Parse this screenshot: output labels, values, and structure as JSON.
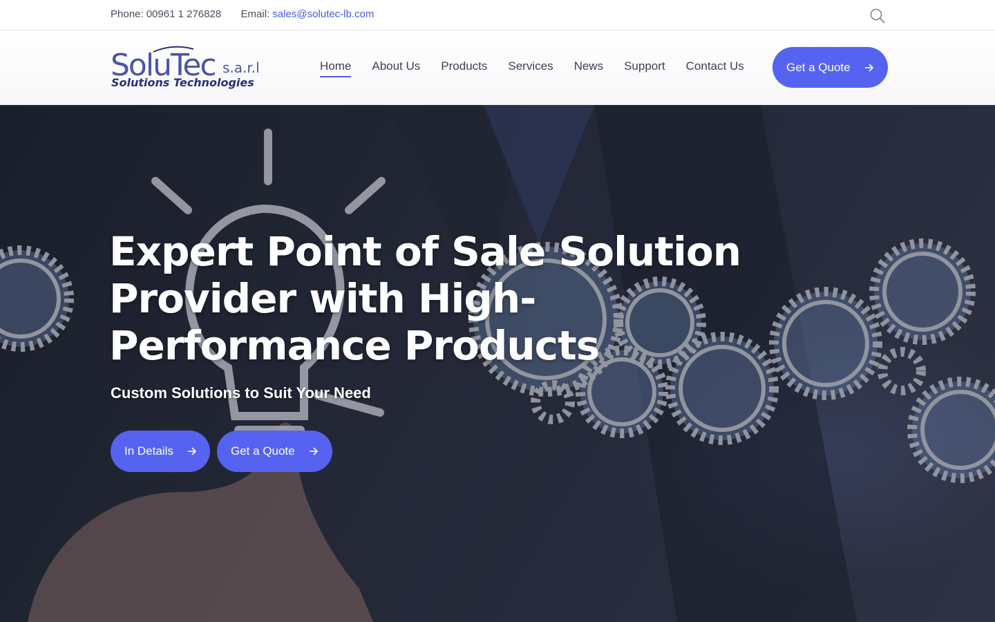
{
  "topbar": {
    "phone_label": "Phone:",
    "phone": "00961 1 276828",
    "email_label": "Email:",
    "email": "sales@solutec-lb.com",
    "search_icon": "search-icon"
  },
  "header": {
    "logo": {
      "name": "SoluTec",
      "suffix": "s.a.r.l",
      "tagline": "Solutions Technologies"
    },
    "nav": [
      {
        "label": "Home",
        "active": true
      },
      {
        "label": "About Us"
      },
      {
        "label": "Products"
      },
      {
        "label": "Services"
      },
      {
        "label": "News"
      },
      {
        "label": "Support"
      },
      {
        "label": "Contact Us"
      }
    ],
    "cta_label": "Get a Quote",
    "cta_icon": "arrow-right-icon"
  },
  "hero": {
    "title": "Expert Point of Sale Solution Provider with High- Performance Products",
    "subtitle": "Custom Solutions to Suit Your Need",
    "buttons": [
      {
        "label": "In Details",
        "icon": "arrow-right-icon"
      },
      {
        "label": "Get a Quote",
        "icon": "arrow-right-icon"
      }
    ]
  },
  "colors": {
    "accent": "#5563f0",
    "link": "#4a5ad6",
    "logo_blue": "#4a55a8",
    "logo_dark": "#2a2f7a"
  }
}
